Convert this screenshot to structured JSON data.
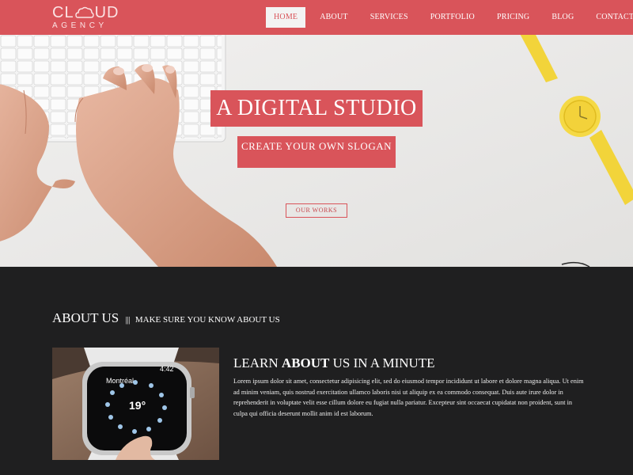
{
  "brand": {
    "logo_top": "CLOUD",
    "logo_top_a": "CL",
    "logo_top_b": "UD",
    "logo_bottom": "AGENCY"
  },
  "nav": {
    "items": [
      {
        "label": "HOME",
        "active": true
      },
      {
        "label": "ABOUT",
        "active": false
      },
      {
        "label": "SERVICES",
        "active": false
      },
      {
        "label": "PORTFOLIO",
        "active": false
      },
      {
        "label": "PRICING",
        "active": false
      },
      {
        "label": "BLOG",
        "active": false
      },
      {
        "label": "CONTACT",
        "active": false
      }
    ]
  },
  "hero": {
    "title": "A DIGITAL STUDIO",
    "slogan": "CREATE YOUR OWN SLOGAN",
    "button": "OUR WORKS"
  },
  "about": {
    "heading": "ABOUT US",
    "separator": "|||",
    "heading_sub": "MAKE SURE YOU KNOW ABOUT US",
    "subtitle_pre": "LEARN",
    "subtitle_bold": "ABOUT",
    "subtitle_post": "US IN A MINUTE",
    "body": "Lorem ipsum dolor sit amet, consectetur adipisicing elit, sed do eiusmod tempor incididunt ut labore et dolore magna aliqua. Ut enim ad minim veniam, quis nostrud exercitation ullamco laboris nisi ut aliquip ex ea commodo consequat. Duis aute irure dolor in reprehenderit in voluptate velit esse cillum dolore eu fugiat nulla pariatur. Excepteur sint occaecat cupidatat non proident, sunt in culpa qui officia deserunt mollit anim id est laborum."
  },
  "watch_screen": {
    "city": "Montréal",
    "time": "4:42",
    "temp": "19°"
  },
  "colors": {
    "accent": "#d9545a",
    "dark": "#1f1f20",
    "hero_bg": "#ecebea"
  }
}
